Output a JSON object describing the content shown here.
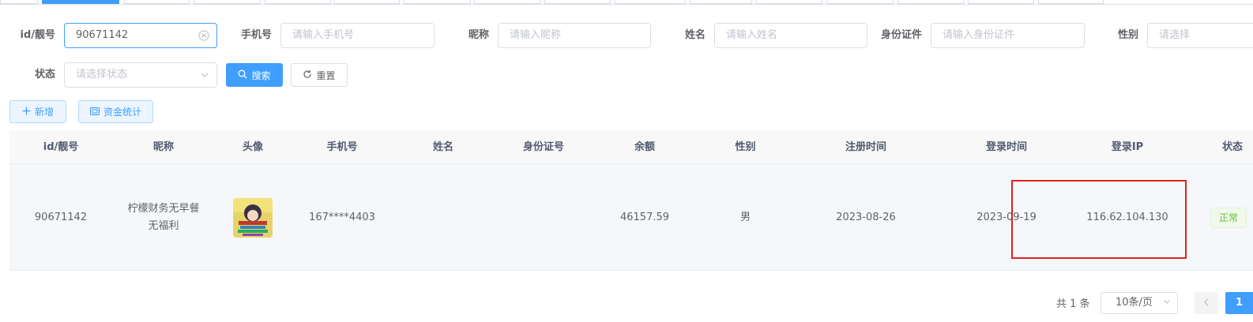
{
  "search_form": {
    "id_label": "id/靓号",
    "id_value": "90671142",
    "phone_label": "手机号",
    "phone_placeholder": "请输入手机号",
    "nickname_label": "昵称",
    "nickname_placeholder": "请输入昵称",
    "name_label": "姓名",
    "name_placeholder": "请输入姓名",
    "idcard_label": "身份证件",
    "idcard_placeholder": "请输入身份证件",
    "gender_label": "性别",
    "gender_placeholder": "请选择",
    "status_label": "状态",
    "status_placeholder": "请选择状态",
    "search_label": "搜索",
    "reset_label": "重置"
  },
  "toolbar": {
    "add_label": "新增",
    "stats_label": "资金统计"
  },
  "table": {
    "columns": [
      "id/靓号",
      "昵称",
      "头像",
      "手机号",
      "姓名",
      "身份证号",
      "余额",
      "性别",
      "注册时间",
      "登录时间",
      "登录IP",
      "状态"
    ],
    "rows": [
      {
        "id": "90671142",
        "nickname_line1": "柠檬财务无早餐",
        "nickname_line2": "无福利",
        "phone": "167****4403",
        "name": "",
        "id_card": "",
        "balance": "46157.59",
        "gender": "男",
        "register_date": "2023-08-26",
        "login_date": "2023-09-19",
        "login_ip": "116.62.104.130",
        "status": "正常"
      }
    ]
  },
  "pagination": {
    "total": "共 1 条",
    "page_size": "10条/页",
    "current_page": "1"
  },
  "colors": {
    "primary": "#409eff",
    "highlight": "#e02020",
    "success": "#67c23a"
  }
}
